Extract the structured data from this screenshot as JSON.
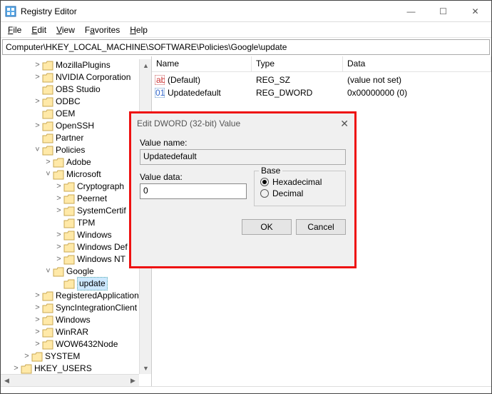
{
  "window": {
    "title": "Registry Editor",
    "minimize_glyph": "—",
    "maximize_glyph": "☐",
    "close_glyph": "✕"
  },
  "menu": {
    "file": "File",
    "edit": "Edit",
    "view": "View",
    "favorites": "Favorites",
    "help": "Help"
  },
  "address": "Computer\\HKEY_LOCAL_MACHINE\\SOFTWARE\\Policies\\Google\\update",
  "columns": {
    "name": "Name",
    "type": "Type",
    "data": "Data"
  },
  "rows": [
    {
      "name": "(Default)",
      "type": "REG_SZ",
      "data": "(value not set)",
      "icon": "str"
    },
    {
      "name": "Updatedefault",
      "type": "REG_DWORD",
      "data": "0x00000000 (0)",
      "icon": "bin"
    }
  ],
  "tree": {
    "items": [
      {
        "indent": 3,
        "twisty": ">",
        "label": "MozillaPlugins"
      },
      {
        "indent": 3,
        "twisty": ">",
        "label": "NVIDIA Corporation"
      },
      {
        "indent": 3,
        "twisty": "",
        "label": "OBS Studio"
      },
      {
        "indent": 3,
        "twisty": ">",
        "label": "ODBC"
      },
      {
        "indent": 3,
        "twisty": "",
        "label": "OEM"
      },
      {
        "indent": 3,
        "twisty": ">",
        "label": "OpenSSH"
      },
      {
        "indent": 3,
        "twisty": "",
        "label": "Partner"
      },
      {
        "indent": 3,
        "twisty": "v",
        "label": "Policies"
      },
      {
        "indent": 4,
        "twisty": ">",
        "label": "Adobe"
      },
      {
        "indent": 4,
        "twisty": "v",
        "label": "Microsoft"
      },
      {
        "indent": 5,
        "twisty": ">",
        "label": "Cryptograph"
      },
      {
        "indent": 5,
        "twisty": ">",
        "label": "Peernet"
      },
      {
        "indent": 5,
        "twisty": ">",
        "label": "SystemCertif"
      },
      {
        "indent": 5,
        "twisty": "",
        "label": "TPM"
      },
      {
        "indent": 5,
        "twisty": ">",
        "label": "Windows"
      },
      {
        "indent": 5,
        "twisty": ">",
        "label": "Windows Def"
      },
      {
        "indent": 5,
        "twisty": ">",
        "label": "Windows NT"
      },
      {
        "indent": 4,
        "twisty": "v",
        "label": "Google"
      },
      {
        "indent": 5,
        "twisty": "",
        "label": "update",
        "selected": true
      },
      {
        "indent": 3,
        "twisty": ">",
        "label": "RegisteredApplication"
      },
      {
        "indent": 3,
        "twisty": ">",
        "label": "SyncIntegrationClient"
      },
      {
        "indent": 3,
        "twisty": ">",
        "label": "Windows"
      },
      {
        "indent": 3,
        "twisty": ">",
        "label": "WinRAR"
      },
      {
        "indent": 3,
        "twisty": ">",
        "label": "WOW6432Node"
      },
      {
        "indent": 2,
        "twisty": ">",
        "label": "SYSTEM"
      },
      {
        "indent": 1,
        "twisty": ">",
        "label": "HKEY_USERS"
      }
    ]
  },
  "dialog": {
    "title": "Edit DWORD (32-bit) Value",
    "close_glyph": "✕",
    "value_name_label": "Value name:",
    "value_name": "Updatedefault",
    "value_data_label": "Value data:",
    "value_data": "0",
    "base_label": "Base",
    "hex_label": "Hexadecimal",
    "dec_label": "Decimal",
    "base_selected": "hex",
    "ok": "OK",
    "cancel": "Cancel"
  }
}
